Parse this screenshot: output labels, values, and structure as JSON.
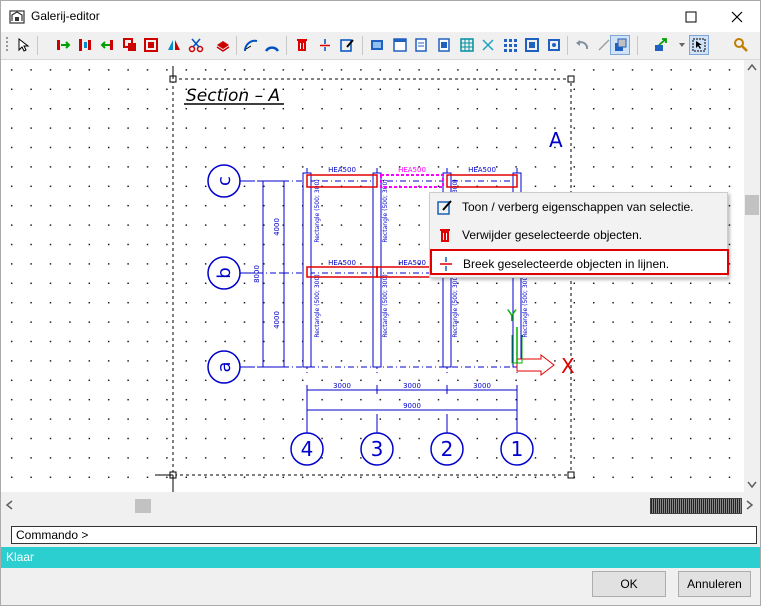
{
  "window": {
    "title": "Galerij-editor"
  },
  "drawing": {
    "section_title": "Section – A",
    "corner_label": "A",
    "beam_labels": [
      "HEA500",
      "HEA500",
      "HEA500",
      "HEA500",
      "HEA500"
    ],
    "column_label": "Rectangle (500; 300)",
    "dims_vertical": [
      "4000",
      "8000",
      "4000"
    ],
    "dims_horizontal": [
      "3000",
      "3000",
      "3000"
    ],
    "dim_total": "9000",
    "row_axes": [
      "c",
      "b",
      "a"
    ],
    "col_axes": [
      "4",
      "3",
      "2",
      "1"
    ],
    "axis_x": "X",
    "axis_y": "Y"
  },
  "context_menu": {
    "items": [
      {
        "label": "Toon / verberg eigenschappen van selectie."
      },
      {
        "label": "Verwijder geselecteerde objecten."
      },
      {
        "label": "Breek geselecteerde objecten in lijnen."
      }
    ]
  },
  "command": {
    "prompt": "Commando >"
  },
  "status": {
    "text": "Klaar"
  },
  "buttons": {
    "ok": "OK",
    "cancel": "Annuleren"
  },
  "colors": {
    "status_bar": "#2ccfcf",
    "drawing_blue": "#0000cc",
    "highlight": "#e00000",
    "selection": "#ff00ff"
  }
}
